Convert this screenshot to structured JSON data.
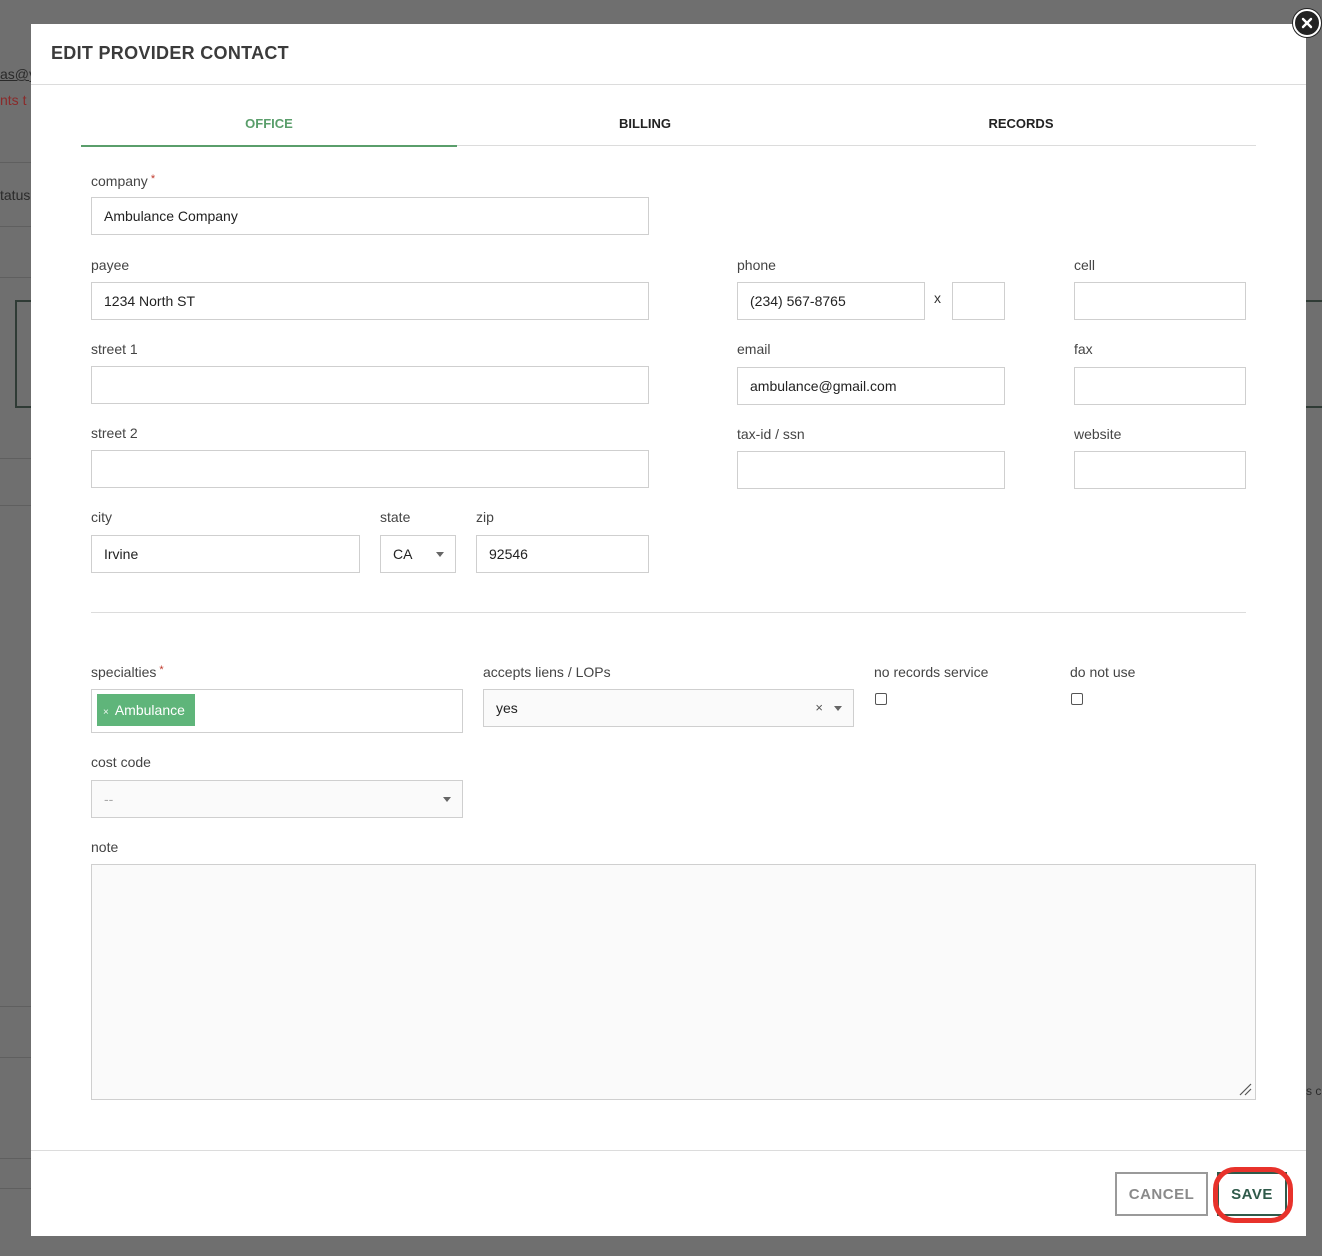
{
  "background": {
    "fragment_email": "as@y",
    "fragment_note": "nts t",
    "fragment_status": "tatus",
    "fragment_right": "s c"
  },
  "modal": {
    "title": "EDIT PROVIDER CONTACT",
    "close_icon": "close-circle-icon"
  },
  "tabs": [
    {
      "label": "OFFICE",
      "active": true
    },
    {
      "label": "BILLING",
      "active": false
    },
    {
      "label": "RECORDS",
      "active": false
    }
  ],
  "form": {
    "company": {
      "label": "company",
      "value": "Ambulance Company",
      "required": "*"
    },
    "payee": {
      "label": "payee",
      "value": "1234 North ST"
    },
    "street1": {
      "label": "street 1",
      "value": ""
    },
    "street2": {
      "label": "street 2",
      "value": ""
    },
    "city": {
      "label": "city",
      "value": "Irvine"
    },
    "state": {
      "label": "state",
      "value": "CA"
    },
    "zip": {
      "label": "zip",
      "value": "92546"
    },
    "phone": {
      "label": "phone",
      "value": "(234) 567-8765",
      "ext_separator": "x",
      "ext": ""
    },
    "cell": {
      "label": "cell",
      "value": ""
    },
    "email": {
      "label": "email",
      "value": "ambulance@gmail.com"
    },
    "fax": {
      "label": "fax",
      "value": ""
    },
    "taxid": {
      "label": "tax-id / ssn",
      "value": ""
    },
    "website": {
      "label": "website",
      "value": ""
    },
    "specialties": {
      "label": "specialties",
      "required": "*",
      "tags": [
        "Ambulance"
      ],
      "tag_remove": "×"
    },
    "accepts_liens": {
      "label": "accepts liens / LOPs",
      "value": "yes",
      "clear": "×"
    },
    "no_records_service": {
      "label": "no records service",
      "checked": false
    },
    "do_not_use": {
      "label": "do not use",
      "checked": false
    },
    "cost_code": {
      "label": "cost code",
      "value": "--"
    },
    "note": {
      "label": "note",
      "value": ""
    }
  },
  "footer": {
    "cancel_label": "CANCEL",
    "save_label": "SAVE"
  },
  "colors": {
    "accent_green": "#5a9e6b",
    "tag_green": "#5fb57a",
    "save_dark_green": "#2f5a4a",
    "highlight_red": "#e8322b",
    "required_red": "#c0392b"
  }
}
